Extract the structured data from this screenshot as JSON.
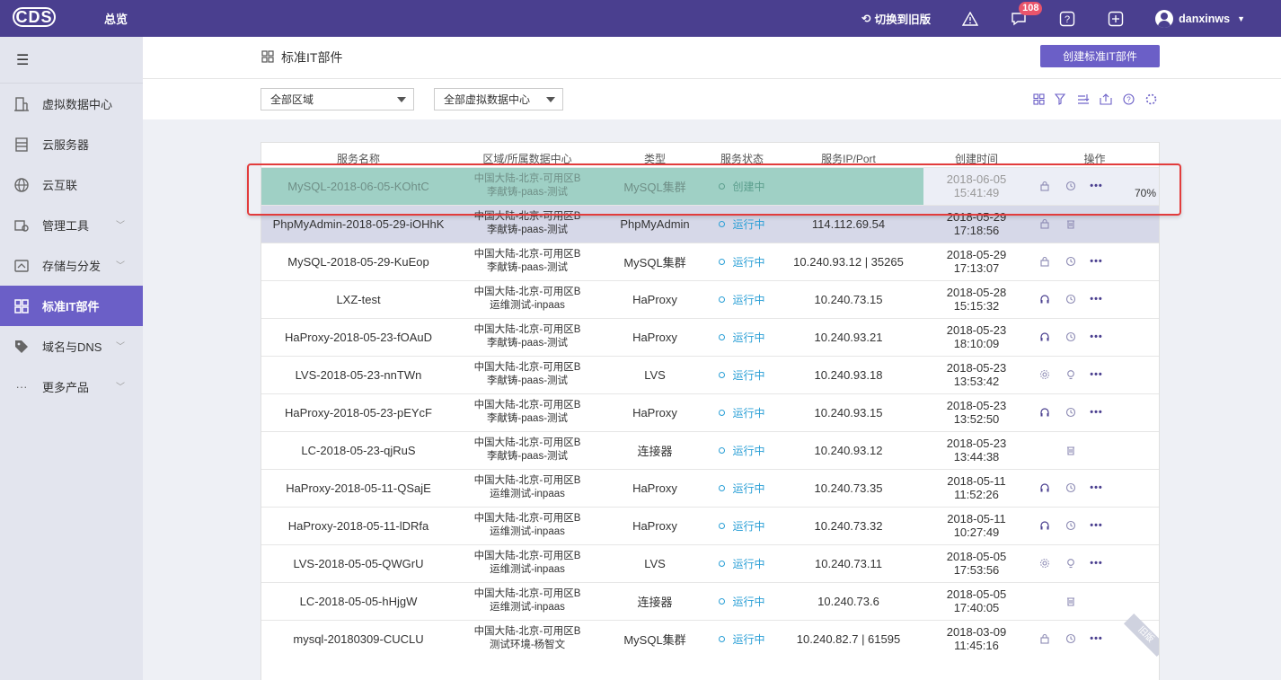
{
  "topbar": {
    "logo": "CDS",
    "title": "总览",
    "switch_old": "切换到旧版",
    "message_badge": "108",
    "user": "danxinws"
  },
  "sidebar": {
    "items": [
      {
        "label": "虚拟数据中心",
        "icon": "building-icon",
        "expandable": false
      },
      {
        "label": "云服务器",
        "icon": "server-icon",
        "expandable": false
      },
      {
        "label": "云互联",
        "icon": "globe-icon",
        "expandable": false
      },
      {
        "label": "管理工具",
        "icon": "tools-icon",
        "expandable": true
      },
      {
        "label": "存储与分发",
        "icon": "storage-icon",
        "expandable": true
      },
      {
        "label": "标准IT部件",
        "icon": "grid-icon",
        "expandable": false,
        "active": true
      },
      {
        "label": "域名与DNS",
        "icon": "tag-icon",
        "expandable": true
      },
      {
        "label": "更多产品",
        "icon": "dots-icon",
        "expandable": true
      }
    ]
  },
  "page": {
    "title": "标准IT部件",
    "create_button": "创建标准IT部件",
    "filter_region": "全部区域",
    "filter_vdc": "全部虚拟数据中心"
  },
  "table": {
    "headers": [
      "服务名称",
      "区域/所属数据中心",
      "类型",
      "服务状态",
      "服务IP/Port",
      "创建时间",
      "操作"
    ],
    "progress_label": "70%",
    "old_label": "旧版",
    "rows": [
      {
        "name": "MySQL-2018-06-05-KOhtC",
        "region": "中国大陆-北京-可用区B",
        "dc": "李献铸-paas-测试",
        "type": "MySQL集群",
        "status": "创建中",
        "ip": "",
        "time": "2018-06-05 15:41:49"
      },
      {
        "name": "PhpMyAdmin-2018-05-29-iOHhK",
        "region": "中国大陆-北京-可用区B",
        "dc": "李献铸-paas-测试",
        "type": "PhpMyAdmin",
        "status": "运行中",
        "ip": "114.112.69.54",
        "time": "2018-05-29 17:18:56"
      },
      {
        "name": "MySQL-2018-05-29-KuEop",
        "region": "中国大陆-北京-可用区B",
        "dc": "李献铸-paas-测试",
        "type": "MySQL集群",
        "status": "运行中",
        "ip": "10.240.93.12 | 35265",
        "time": "2018-05-29 17:13:07"
      },
      {
        "name": "LXZ-test",
        "region": "中国大陆-北京-可用区B",
        "dc": "运维测试-inpaas",
        "type": "HaProxy",
        "status": "运行中",
        "ip": "10.240.73.15",
        "time": "2018-05-28 15:15:32"
      },
      {
        "name": "HaProxy-2018-05-23-fOAuD",
        "region": "中国大陆-北京-可用区B",
        "dc": "李献铸-paas-测试",
        "type": "HaProxy",
        "status": "运行中",
        "ip": "10.240.93.21",
        "time": "2018-05-23 18:10:09"
      },
      {
        "name": "LVS-2018-05-23-nnTWn",
        "region": "中国大陆-北京-可用区B",
        "dc": "李献铸-paas-测试",
        "type": "LVS",
        "status": "运行中",
        "ip": "10.240.93.18",
        "time": "2018-05-23 13:53:42"
      },
      {
        "name": "HaProxy-2018-05-23-pEYcF",
        "region": "中国大陆-北京-可用区B",
        "dc": "李献铸-paas-测试",
        "type": "HaProxy",
        "status": "运行中",
        "ip": "10.240.93.15",
        "time": "2018-05-23 13:52:50"
      },
      {
        "name": "LC-2018-05-23-qjRuS",
        "region": "中国大陆-北京-可用区B",
        "dc": "李献铸-paas-测试",
        "type": "连接器",
        "status": "运行中",
        "ip": "10.240.93.12",
        "time": "2018-05-23 13:44:38"
      },
      {
        "name": "HaProxy-2018-05-11-QSajE",
        "region": "中国大陆-北京-可用区B",
        "dc": "运维测试-inpaas",
        "type": "HaProxy",
        "status": "运行中",
        "ip": "10.240.73.35",
        "time": "2018-05-11 11:52:26"
      },
      {
        "name": "HaProxy-2018-05-11-lDRfa",
        "region": "中国大陆-北京-可用区B",
        "dc": "运维测试-inpaas",
        "type": "HaProxy",
        "status": "运行中",
        "ip": "10.240.73.32",
        "time": "2018-05-11 10:27:49"
      },
      {
        "name": "LVS-2018-05-05-QWGrU",
        "region": "中国大陆-北京-可用区B",
        "dc": "运维测试-inpaas",
        "type": "LVS",
        "status": "运行中",
        "ip": "10.240.73.11",
        "time": "2018-05-05 17:53:56"
      },
      {
        "name": "LC-2018-05-05-hHjgW",
        "region": "中国大陆-北京-可用区B",
        "dc": "运维测试-inpaas",
        "type": "连接器",
        "status": "运行中",
        "ip": "10.240.73.6",
        "time": "2018-05-05 17:40:05"
      },
      {
        "name": "mysql-20180309-CUCLU",
        "region": "中国大陆-北京-可用区B",
        "dc": "测试环境-杨智文",
        "type": "MySQL集群",
        "status": "运行中",
        "ip": "10.240.82.7 | 61595",
        "time": "2018-03-09 11:45:16"
      }
    ]
  }
}
